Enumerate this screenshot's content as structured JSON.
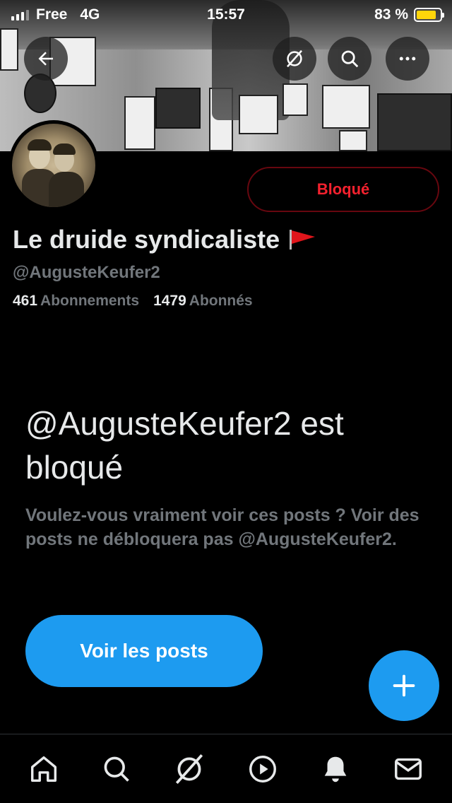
{
  "status_bar": {
    "carrier": "Free",
    "network": "4G",
    "time": "15:57",
    "battery_percent": "83 %",
    "battery_level": 0.83,
    "battery_color": "#ffd60a"
  },
  "header": {
    "back_icon": "arrow-left-icon",
    "grok_icon": "grok-icon",
    "search_icon": "search-icon",
    "more_icon": "more-icon"
  },
  "profile": {
    "display_name": "Le druide syndicaliste",
    "flag_icon": "red-flag-icon",
    "handle": "@AugusteKeufer2",
    "following_count": "461",
    "following_label": "Abonnements",
    "followers_count": "1479",
    "followers_label": "Abonnés",
    "blocked_button_label": "Bloqué"
  },
  "blocked_notice": {
    "title": "@AugusteKeufer2 est bloqué",
    "description": "Voulez-vous vraiment voir ces posts ? Voir des posts ne débloquera pas @AugusteKeufer2.",
    "view_posts_label": "Voir les posts"
  },
  "fab": {
    "icon": "plus-icon"
  },
  "tabbar": {
    "items": [
      {
        "name": "home",
        "icon": "home-icon"
      },
      {
        "name": "search",
        "icon": "search-icon"
      },
      {
        "name": "grok",
        "icon": "grok-icon"
      },
      {
        "name": "video",
        "icon": "play-icon"
      },
      {
        "name": "notifications",
        "icon": "bell-icon"
      },
      {
        "name": "messages",
        "icon": "mail-icon"
      }
    ]
  },
  "colors": {
    "accent": "#1d9bf0",
    "blocked_red": "#f4212e",
    "muted_text": "#71767b"
  }
}
